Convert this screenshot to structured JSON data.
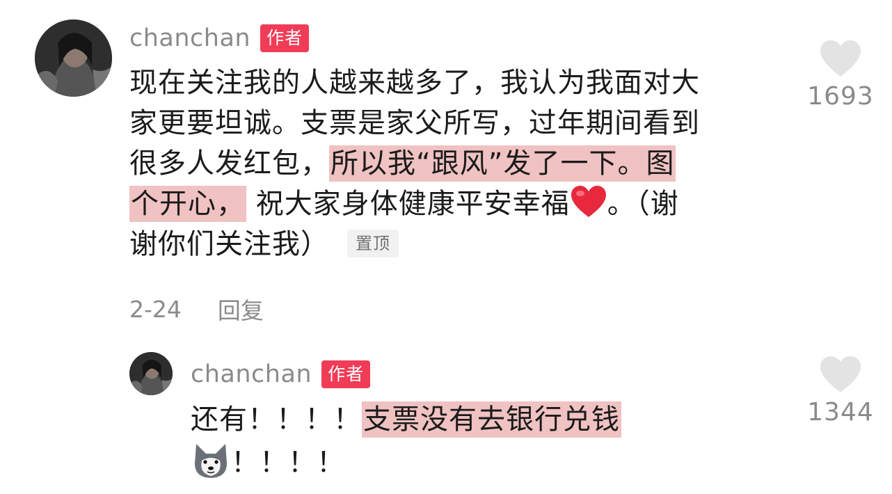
{
  "comment": {
    "username": "chanchan",
    "author_badge": "作者",
    "lines": [
      "现在关注我的人越来越多了，我认为我面对大",
      "家更要坦诚。支票是家父所写，过年期间看到",
      "很多人发红包，",
      "所以我“跟风”发了一下。图",
      "个开心，",
      "祝大家身体健康平安幸福",
      "。（谢",
      "谢你们关注我）"
    ],
    "pinned_label": "置顶",
    "date": "2-24",
    "reply_label": "回复",
    "likes": "1693"
  },
  "reply": {
    "username": "chanchan",
    "author_badge": "作者",
    "text_plain": "还有！！！！",
    "text_highlight": "支票没有去银行兑钱",
    "text_tail": "！！！！",
    "likes": "1344"
  },
  "icons": {
    "like": "heart-outline-icon",
    "heart_emoji": "red-heart-emoji-icon",
    "dog_emoji": "husky-dog-emoji-icon"
  },
  "colors": {
    "author_badge": "#f03c57",
    "highlight": "#f0c2c2",
    "secondary_text": "#8a8a8a",
    "like_icon": "#e3e3e3"
  }
}
